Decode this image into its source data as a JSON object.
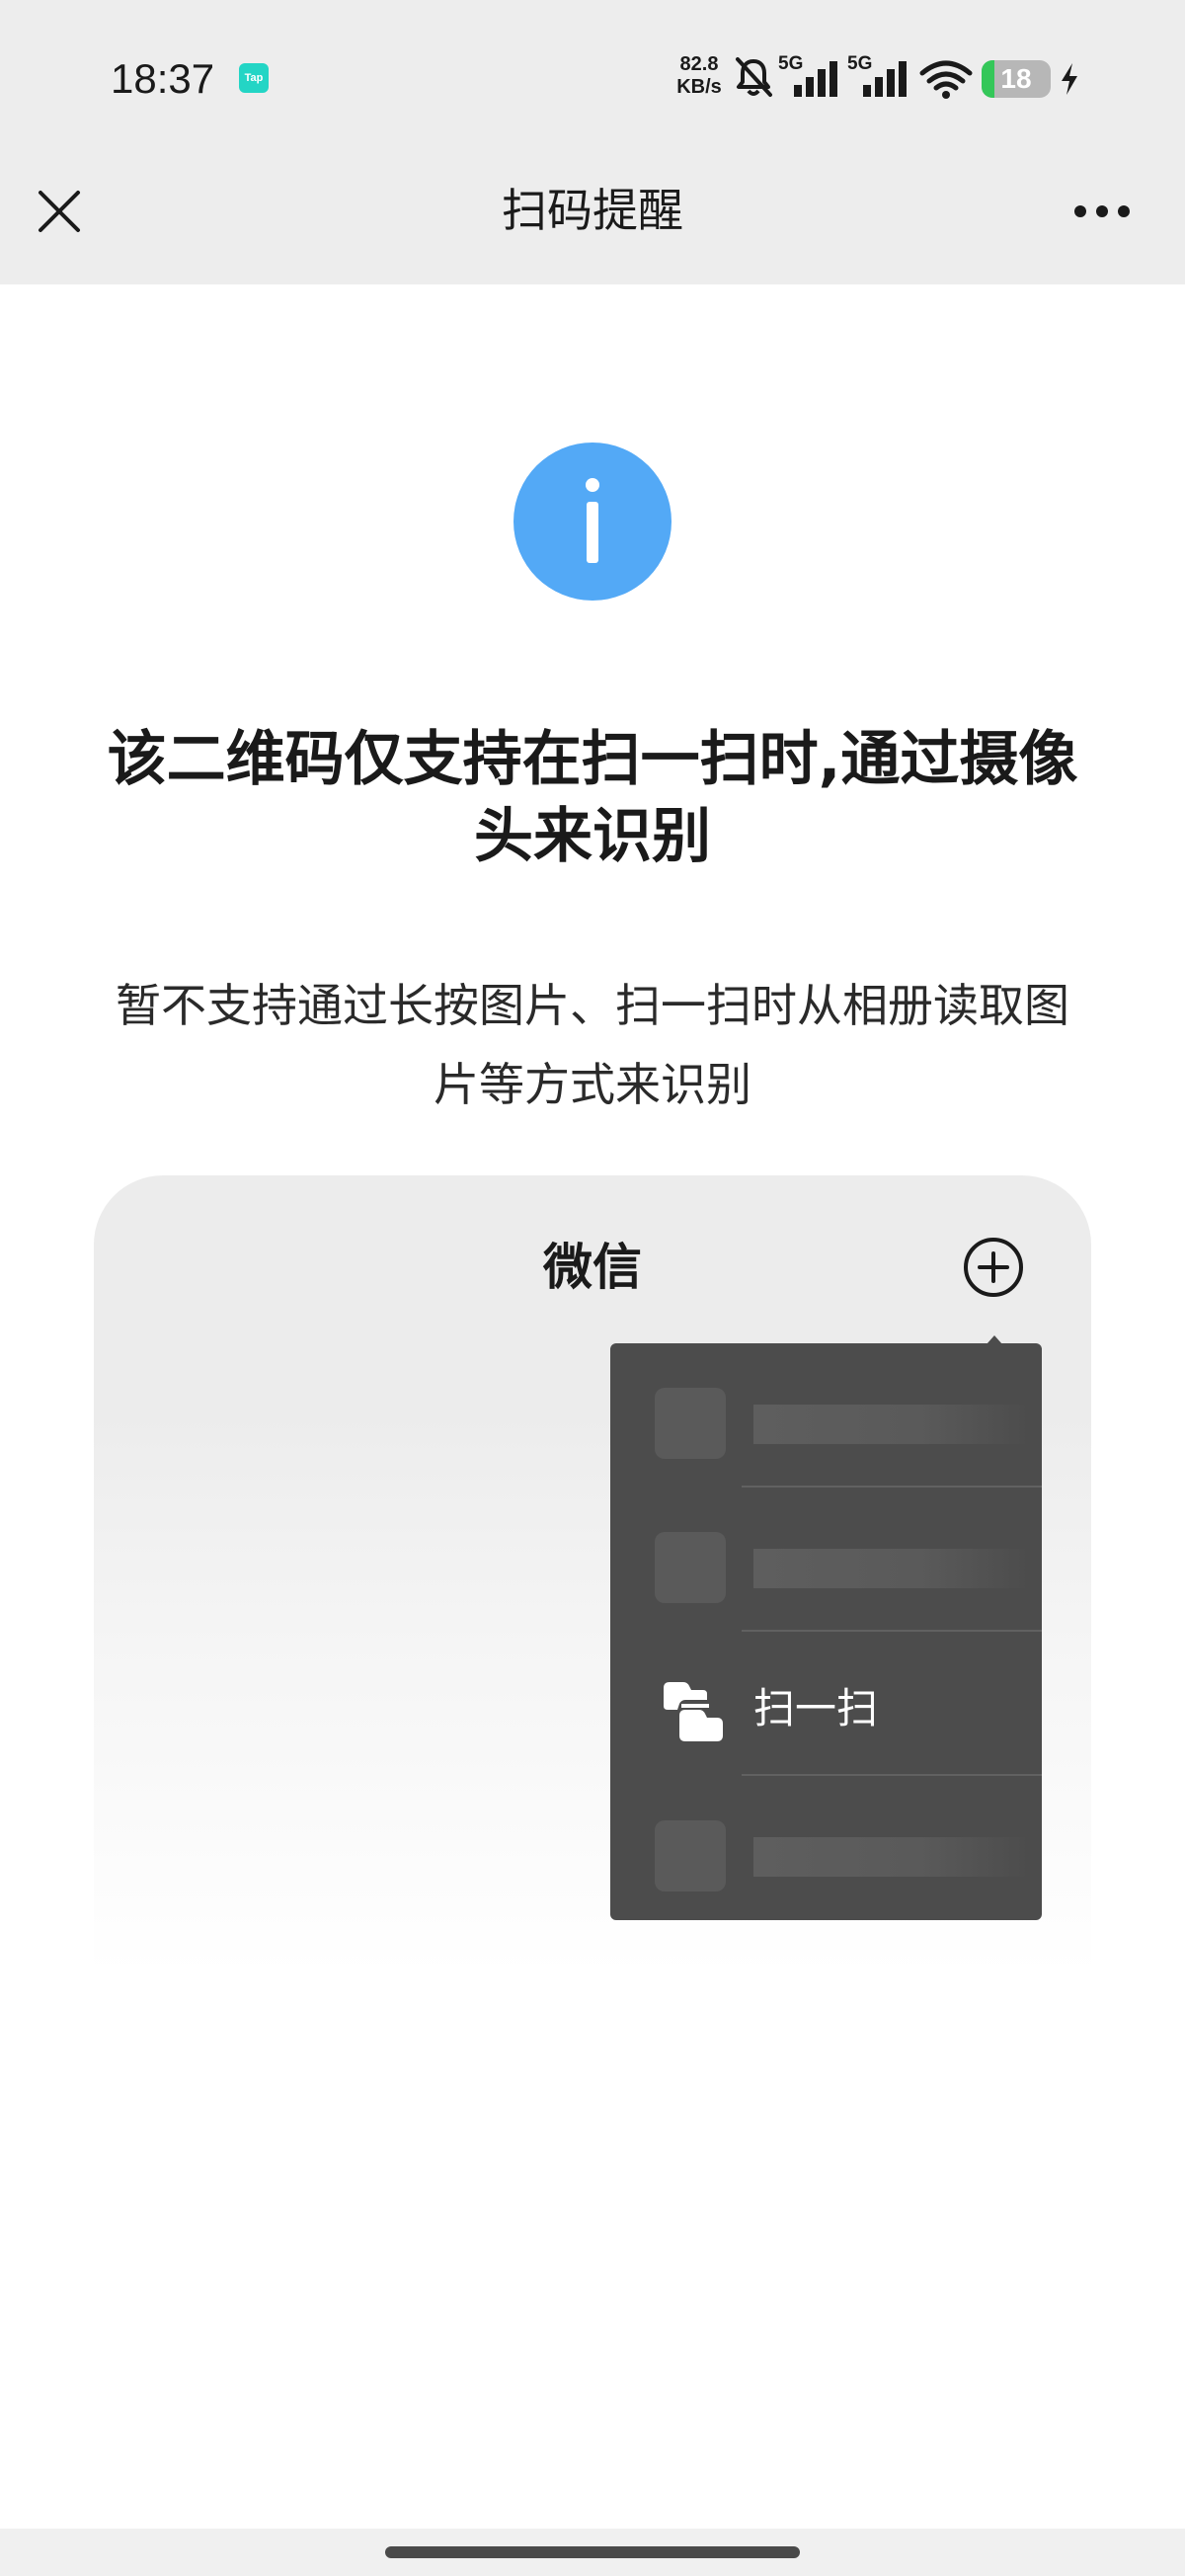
{
  "status_bar": {
    "time": "18:37",
    "tap_badge": "Tap",
    "net_speed_value": "82.8",
    "net_speed_unit": "KB/s",
    "sim1_label": "5G",
    "sim2_label": "5G",
    "battery_level": "18",
    "battery_fraction": 0.18,
    "battery_color": "#34c759",
    "charging": true
  },
  "nav": {
    "title": "扫码提醒",
    "close_icon": "close-icon",
    "more_icon": "more-dots-icon"
  },
  "main": {
    "info_icon": "info-icon",
    "info_icon_color": "#53a9f6",
    "title": "该二维码仅支持在扫一扫时,通过摄像头来识别",
    "subtitle": "暂不支持通过长按图片、扫一扫时从相册读取图片等方式来识别"
  },
  "illustration": {
    "app_title": "微信",
    "plus_icon": "plus-circle-icon",
    "menu": {
      "items": [
        {
          "label": "",
          "placeholder": true
        },
        {
          "label": "",
          "placeholder": true
        },
        {
          "label": "扫一扫",
          "placeholder": false,
          "icon": "scan-icon"
        },
        {
          "label": "",
          "placeholder": true
        }
      ]
    }
  }
}
